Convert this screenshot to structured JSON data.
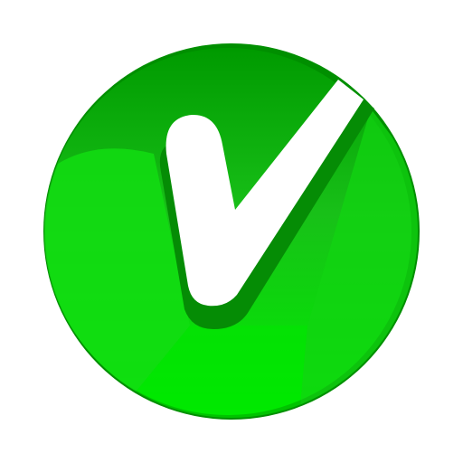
{
  "icon": {
    "name": "checkmark-badge-icon",
    "shape": "circle",
    "glyph": "check-mark"
  },
  "colors": {
    "background": "#ffffff",
    "circle_light": "#00ee00",
    "circle_mid": "#18c018",
    "circle_dark": "#009a00",
    "rim_dark": "#008f00",
    "check_shadow": "#058c05",
    "check_mark": "#ffffff"
  }
}
